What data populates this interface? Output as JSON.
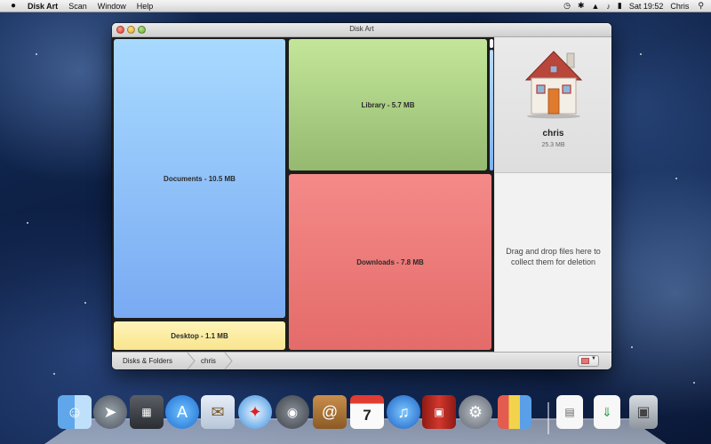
{
  "menubar": {
    "apple_icon": "",
    "app_name": "Disk Art",
    "items": [
      "Scan",
      "Window",
      "Help"
    ],
    "clock": "Sat 19:52",
    "user": "Chris"
  },
  "window": {
    "title": "Disk Art"
  },
  "treemap": {
    "documents": "Documents - 10.5 MB",
    "library": "Library - 5.7 MB",
    "downloads": "Downloads - 7.8 MB",
    "desktop": "Desktop - 1.1 MB"
  },
  "side_panel": {
    "icon": "home-folder-icon",
    "name": "chris",
    "size": "25.3 MB",
    "drop_text": "Drag and drop files here to collect them for deletion"
  },
  "pathbar": {
    "crumbs": [
      "Disks & Folders",
      "chris"
    ]
  },
  "colors": {
    "documents": "#8ec3fb",
    "library": "#a9cf83",
    "downloads": "#ec7a78",
    "desktop": "#fcee9f"
  },
  "dock": {
    "apps": [
      "Finder",
      "Launchpad",
      "Mission Control",
      "App Store",
      "Mail",
      "Safari",
      "FaceTime",
      "Contacts",
      "Calendar",
      "iTunes",
      "Photo Booth",
      "System Preferences",
      "Disk Art",
      "Documents",
      "Downloads",
      "Trash"
    ],
    "calendar_day": "7"
  }
}
